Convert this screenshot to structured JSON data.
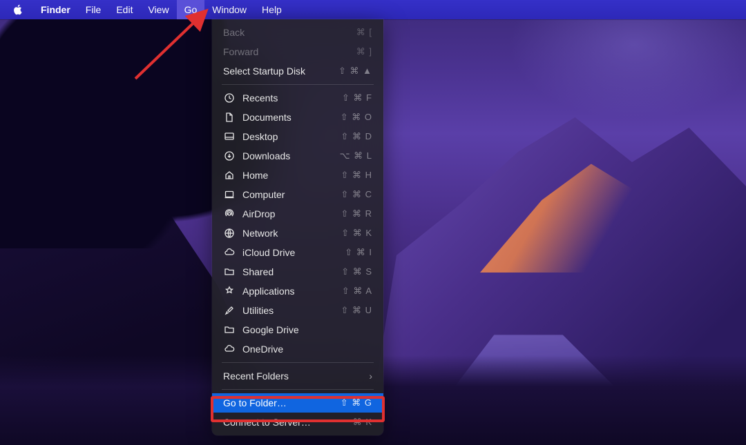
{
  "menubar": {
    "app": "Finder",
    "items": [
      "File",
      "Edit",
      "View",
      "Go",
      "Window",
      "Help"
    ],
    "open": "Go"
  },
  "dropdown": {
    "sections": [
      {
        "items": [
          {
            "id": "back",
            "label": "Back",
            "shortcut": "⌘ [",
            "disabled": true,
            "icon": null
          },
          {
            "id": "forward",
            "label": "Forward",
            "shortcut": "⌘ ]",
            "disabled": true,
            "icon": null
          },
          {
            "id": "startup",
            "label": "Select Startup Disk",
            "shortcut": "⇧ ⌘ ▲",
            "disabled": false,
            "icon": null
          }
        ]
      },
      {
        "items": [
          {
            "id": "recents",
            "label": "Recents",
            "shortcut": "⇧ ⌘ F",
            "icon": "clock-icon"
          },
          {
            "id": "documents",
            "label": "Documents",
            "shortcut": "⇧ ⌘ O",
            "icon": "document-icon"
          },
          {
            "id": "desktop",
            "label": "Desktop",
            "shortcut": "⇧ ⌘ D",
            "icon": "desktop-icon"
          },
          {
            "id": "downloads",
            "label": "Downloads",
            "shortcut": "⌥ ⌘ L",
            "icon": "downloads-icon"
          },
          {
            "id": "home",
            "label": "Home",
            "shortcut": "⇧ ⌘ H",
            "icon": "home-icon"
          },
          {
            "id": "computer",
            "label": "Computer",
            "shortcut": "⇧ ⌘ C",
            "icon": "computer-icon"
          },
          {
            "id": "airdrop",
            "label": "AirDrop",
            "shortcut": "⇧ ⌘ R",
            "icon": "airdrop-icon"
          },
          {
            "id": "network",
            "label": "Network",
            "shortcut": "⇧ ⌘ K",
            "icon": "network-icon"
          },
          {
            "id": "icloud",
            "label": "iCloud Drive",
            "shortcut": "⇧ ⌘ I",
            "icon": "cloud-icon"
          },
          {
            "id": "shared",
            "label": "Shared",
            "shortcut": "⇧ ⌘ S",
            "icon": "folder-icon"
          },
          {
            "id": "applications",
            "label": "Applications",
            "shortcut": "⇧ ⌘ A",
            "icon": "applications-icon"
          },
          {
            "id": "utilities",
            "label": "Utilities",
            "shortcut": "⇧ ⌘ U",
            "icon": "utilities-icon"
          },
          {
            "id": "gdrive",
            "label": "Google Drive",
            "shortcut": "",
            "icon": "folder-icon"
          },
          {
            "id": "onedrive",
            "label": "OneDrive",
            "shortcut": "",
            "icon": "cloud-icon"
          }
        ]
      },
      {
        "items": [
          {
            "id": "recent-folders",
            "label": "Recent Folders",
            "submenu": true,
            "icon": null
          }
        ]
      },
      {
        "items": [
          {
            "id": "goto-folder",
            "label": "Go to Folder…",
            "shortcut": "⇧ ⌘ G",
            "highlighted": true,
            "icon": null
          },
          {
            "id": "connect-server",
            "label": "Connect to Server…",
            "shortcut": "⌘ K",
            "icon": null
          }
        ]
      }
    ]
  },
  "annotations": {
    "arrow_target": "Go",
    "highlight_target": "Go to Folder…"
  }
}
